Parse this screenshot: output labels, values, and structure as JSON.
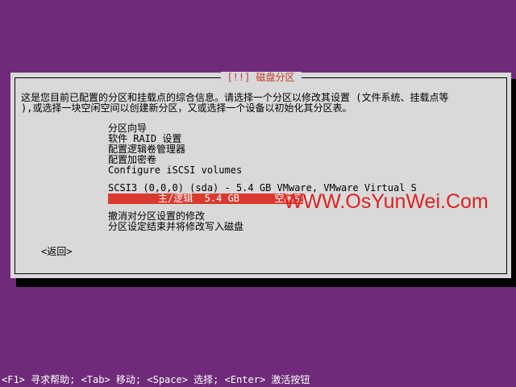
{
  "dialog": {
    "title": "[!!] 磁盘分区",
    "description_line1": "这是您目前已配置的分区和挂载点的综合信息。请选择一个分区以修改其设置 (文件系统、挂载点等",
    "description_line2": "),或选择一块空闲空间以创建新分区，又或选择一个设备以初始化其分区表。",
    "menu_items": [
      "分区向导",
      "软件 RAID 设置",
      "配置逻辑卷管理器",
      "配置加密卷",
      "Configure iSCSI volumes"
    ],
    "disk": "SCSI3 (0,0,0) (sda) - 5.4 GB VMware, VMware Virtual S",
    "selected_partition": "主/逻辑  5.4 GB      空闲空间",
    "actions": [
      "撤消对分区设置的修改",
      "分区设定结束并将修改写入磁盘"
    ],
    "back_button": "<返回>"
  },
  "watermark": "WWW.OsYunWei.Com",
  "statusbar": "<F1> 寻求帮助; <Tab> 移动; <Space> 选择; <Enter> 激活按钮",
  "colors": {
    "background": "#6f2b79",
    "dialog": "#d9d9d9",
    "selection": "#d83a2f",
    "title": "#c0392b"
  }
}
